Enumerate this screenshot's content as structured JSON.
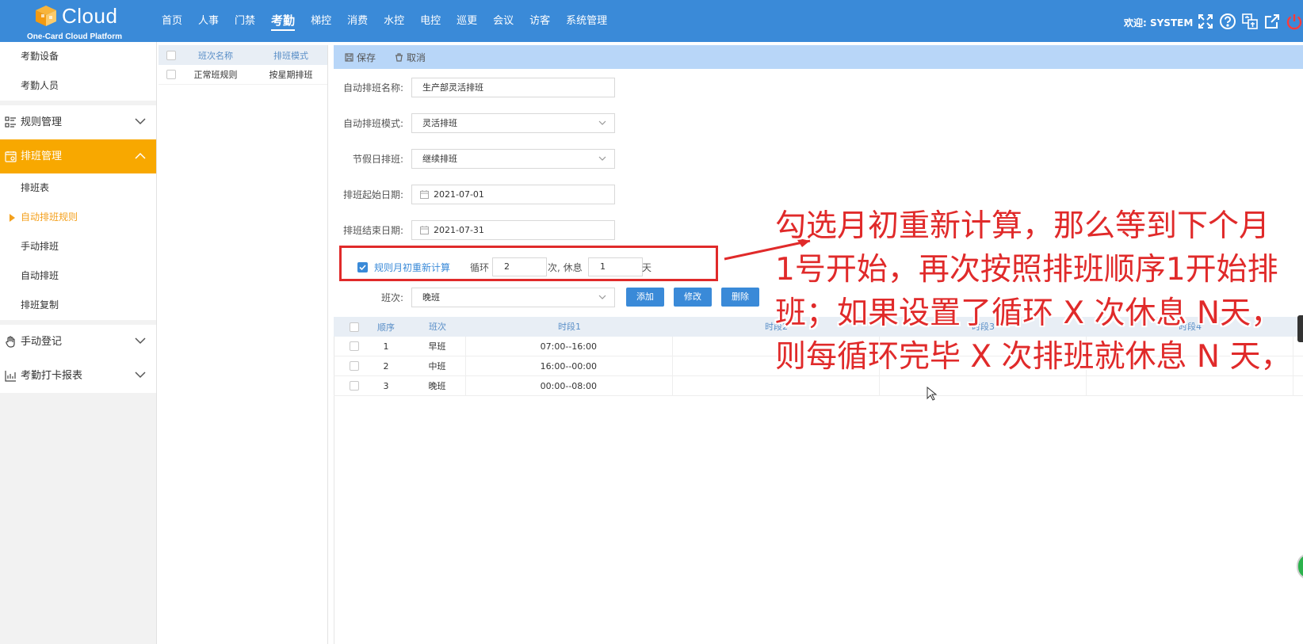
{
  "app": {
    "brand": "Cloud",
    "subtitle": "One-Card Cloud Platform",
    "accent": "#3a8ad8",
    "highlight": "#f8a800"
  },
  "nav": {
    "items": [
      "首页",
      "人事",
      "门禁",
      "考勤",
      "梯控",
      "消费",
      "水控",
      "电控",
      "巡更",
      "会议",
      "访客",
      "系统管理"
    ],
    "active": "考勤"
  },
  "header": {
    "welcome": "欢迎: SYSTEM",
    "icons": [
      "fullscreen-icon",
      "help-icon",
      "language-icon",
      "external-link-icon",
      "power-icon"
    ]
  },
  "sidebar": {
    "top_items": [
      "考勤设备",
      "考勤人员"
    ],
    "groups": [
      {
        "label": "规则管理",
        "icon": "rules-icon",
        "open": false
      },
      {
        "label": "排班管理",
        "icon": "schedule-icon",
        "open": true,
        "children": [
          "排班表",
          "自动排班规则",
          "手动排班",
          "自动排班",
          "排班复制"
        ],
        "active_child": "自动排班规则"
      },
      {
        "label": "手动登记",
        "icon": "hand-icon",
        "open": false
      },
      {
        "label": "考勤打卡报表",
        "icon": "report-icon",
        "open": false
      }
    ]
  },
  "rule_list": {
    "headers": [
      "班次名称",
      "排班模式"
    ],
    "rows": [
      [
        "正常班规则",
        "按星期排班"
      ]
    ]
  },
  "toolbar": {
    "save_label": "保存",
    "cancel_label": "取消"
  },
  "form": {
    "name_label": "自动排班名称:",
    "name_value": "生产部灵活排班",
    "mode_label": "自动排班模式:",
    "mode_value": "灵活排班",
    "holiday_label": "节假日排班:",
    "holiday_value": "继续排班",
    "start_label": "排班起始日期:",
    "start_value": "2021-07-01",
    "end_label": "排班结束日期:",
    "end_value": "2021-07-31",
    "recalc_label": "规则月初重新计算",
    "recalc_checked": true,
    "cycle_label": "循环",
    "cycle_value": "2",
    "times_rest_label": "次, 休息",
    "rest_value": "1",
    "day_label": "天",
    "shift_label": "班次:",
    "shift_value": "晚班",
    "add_label": "添加",
    "edit_label": "修改",
    "delete_label": "删除"
  },
  "shift_table": {
    "headers": [
      "顺序",
      "班次",
      "时段1",
      "时段2",
      "时段3",
      "时段4"
    ],
    "rows": [
      {
        "order": "1",
        "shift": "早班",
        "start": "07:00",
        "end": "16:00"
      },
      {
        "order": "2",
        "shift": "中班",
        "start": "16:00",
        "end": "00:00"
      },
      {
        "order": "3",
        "shift": "晚班",
        "start": "00:00",
        "end": "08:00"
      }
    ],
    "dash": "--"
  },
  "annotation": {
    "text": "勾选月初重新计算，那么等到下个月\n1号开始，再次按照排班顺序1开始排\n班；如果设置了循环 X 次休息 N天，\n则每循环完毕 X 次排班就休息 N 天，",
    "color": "#e02a2a"
  }
}
